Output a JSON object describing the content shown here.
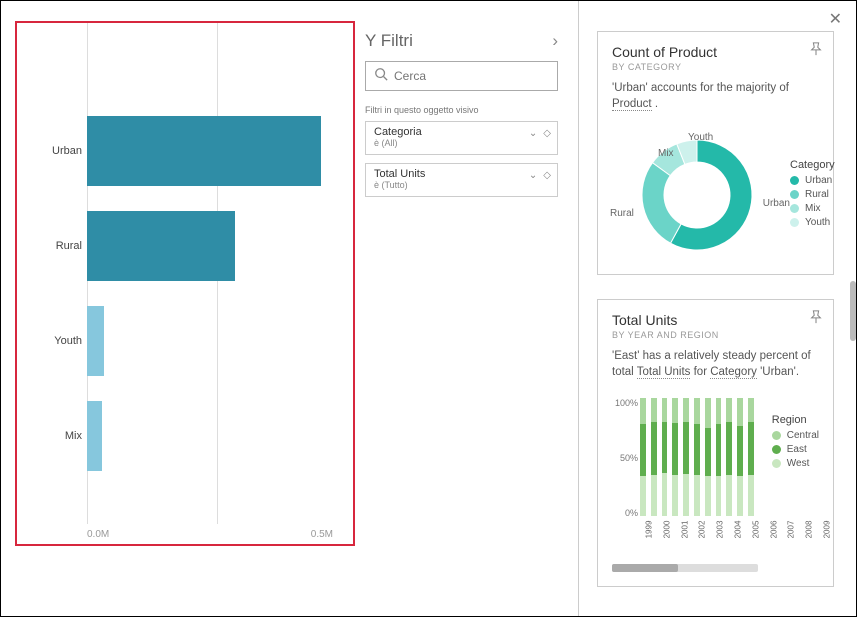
{
  "filters": {
    "header": "Y Filtri",
    "search_placeholder": "Cerca",
    "section_label": "Filtri in questo oggetto visivo",
    "cards": [
      {
        "title": "Categoria",
        "sub": "è (All)"
      },
      {
        "title": "Total Units",
        "sub": "è (Tutto)"
      }
    ]
  },
  "chart_data": [
    {
      "id": "main_bar",
      "type": "bar",
      "orientation": "horizontal",
      "categories": [
        "Urban",
        "Rural",
        "Youth",
        "Mix"
      ],
      "values": [
        0.95,
        0.6,
        0.07,
        0.06
      ],
      "value_unit": "M",
      "xticks": [
        "0.0M",
        "0.5M"
      ],
      "colors": [
        "#2f8da6",
        "#2f8da6",
        "#86c7dd",
        "#86c7dd"
      ],
      "xlim": [
        0,
        1.0
      ]
    },
    {
      "id": "donut_product",
      "type": "pie",
      "hole": 0.6,
      "title": "Count of Product",
      "subtitle": "BY CATEGORY",
      "description_parts": [
        "'Urban' accounts for the majority of ",
        "Product",
        " ."
      ],
      "legend_title": "Category",
      "series": [
        {
          "name": "Urban",
          "value": 58,
          "color": "#24b9a9"
        },
        {
          "name": "Rural",
          "value": 27,
          "color": "#6bd4c8"
        },
        {
          "name": "Mix",
          "value": 9,
          "color": "#a5e6dd"
        },
        {
          "name": "Youth",
          "value": 6,
          "color": "#cdf1ec"
        }
      ]
    },
    {
      "id": "stacked_units",
      "type": "bar",
      "stacked": "100%",
      "title": "Total Units",
      "subtitle": "BY YEAR AND REGION",
      "description_parts": [
        "'East' has a relatively steady percent of total ",
        "Total Units",
        " for ",
        "Category",
        " 'Urban'."
      ],
      "legend_title": "Region",
      "yticks": [
        "100%",
        "50%",
        "0%"
      ],
      "categories": [
        "1999",
        "2000",
        "2001",
        "2002",
        "2003",
        "2004",
        "2005",
        "2006",
        "2007",
        "2008",
        "2009"
      ],
      "series": [
        {
          "name": "Central",
          "color": "#a9d79e",
          "values": [
            22,
            20,
            20,
            21,
            20,
            22,
            25,
            22,
            20,
            23,
            20
          ]
        },
        {
          "name": "East",
          "color": "#5fae4e",
          "values": [
            44,
            45,
            43,
            44,
            44,
            43,
            41,
            44,
            45,
            43,
            45
          ]
        },
        {
          "name": "West",
          "color": "#c9e7c0",
          "values": [
            34,
            35,
            37,
            35,
            36,
            35,
            34,
            34,
            35,
            34,
            35
          ]
        }
      ]
    }
  ]
}
